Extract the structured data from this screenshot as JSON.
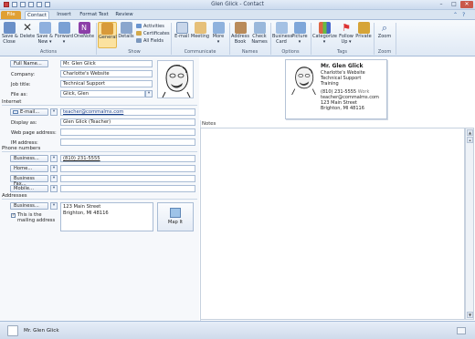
{
  "window": {
    "title": "Glen Glick  -  Contact"
  },
  "tabs": [
    {
      "label": "File"
    },
    {
      "label": "Contact"
    },
    {
      "label": "Insert"
    },
    {
      "label": "Format Text"
    },
    {
      "label": "Review"
    }
  ],
  "ribbon": {
    "actions": {
      "save_close": "Save &\nClose",
      "delete": "Delete",
      "save_new": "Save &\nNew ▾",
      "forward": "Forward\n▾",
      "onenote": "OneNote",
      "group": "Actions"
    },
    "show": {
      "general": "General",
      "details": "Details",
      "activities": "Activities",
      "certificates": "Certificates",
      "all_fields": "All Fields",
      "group": "Show"
    },
    "communicate": {
      "email": "E-mail",
      "meeting": "Meeting",
      "more": "More\n▾",
      "group": "Communicate"
    },
    "names": {
      "address_book": "Address\nBook",
      "check_names": "Check\nNames",
      "group": "Names"
    },
    "options": {
      "business_card": "Business\nCard",
      "picture": "Picture\n▾",
      "group": "Options"
    },
    "tags": {
      "categorize": "Categorize\n▾",
      "follow_up": "Follow\nUp ▾",
      "private": "Private",
      "group": "Tags"
    },
    "zoom": {
      "zoom": "Zoom",
      "group": "Zoom"
    }
  },
  "form": {
    "full_name_btn": "Full Name...",
    "full_name": "Mr. Glen Glick",
    "company_lbl": "Company:",
    "company": "Charlotte's Website",
    "job_title_lbl": "Job title:",
    "job_title": "Technical Support",
    "file_as_lbl": "File as:",
    "file_as": "Glick, Glen",
    "internet": "Internet",
    "email_btn": "E-mail...",
    "email": "teacher@commalms.com",
    "display_as_lbl": "Display as:",
    "display_as": "Glen Glick (Teacher)",
    "web_lbl": "Web page address:",
    "web": "",
    "im_lbl": "IM address:",
    "im": "",
    "phone_numbers": "Phone numbers",
    "business_btn": "Business...",
    "business_phone": "(810) 231-5555",
    "home_btn": "Home...",
    "home_phone": "",
    "business_fax_btn": "Business Fax...",
    "business_fax": "",
    "mobile_btn": "Mobile...",
    "mobile": "",
    "addresses": "Addresses",
    "address_btn": "Business...",
    "address_line1": "123 Main Street",
    "address_line2": "Brighton, MI 48116",
    "mailing_checkbox": "This is the mailing address",
    "map_it": "Map It"
  },
  "card": {
    "name": "Mr. Glen Glick",
    "company": "Charlotte's Website",
    "title": "Technical Support",
    "dept": "Training",
    "phone": "(810) 231-5555",
    "phone_type": "Work",
    "email": "teacher@commalms.com",
    "street": "123 Main Street",
    "city": "Brighton, MI 48116"
  },
  "notes": {
    "label": "Notes"
  },
  "status": {
    "name": "Mr. Glen Glick"
  },
  "colors": {
    "accent": "#e0a033",
    "ribbon_sel": "#fbe2a0"
  }
}
